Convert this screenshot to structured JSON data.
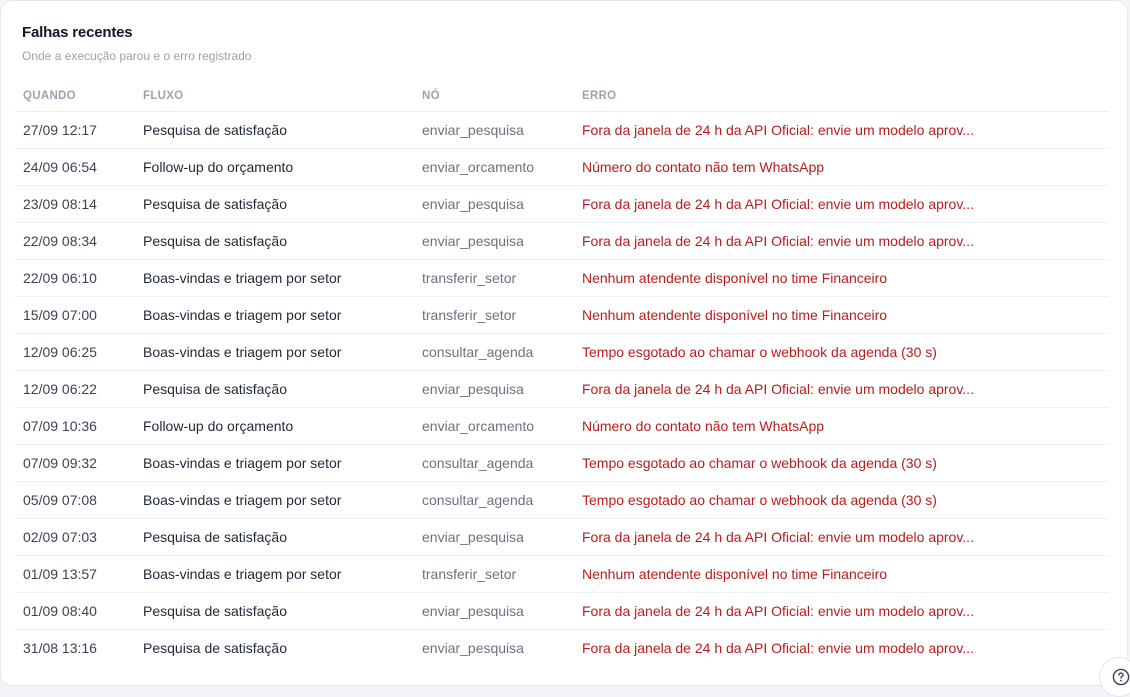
{
  "card": {
    "title": "Falhas recentes",
    "subtitle": "Onde a execução parou e o erro registrado"
  },
  "table": {
    "columns": [
      "QUANDO",
      "FLUXO",
      "NÓ",
      "ERRO"
    ],
    "rows": [
      {
        "when": "27/09 12:17",
        "flow": "Pesquisa de satisfação",
        "node": "enviar_pesquisa",
        "error": "Fora da janela de 24 h da API Oficial: envie um modelo aprov..."
      },
      {
        "when": "24/09 06:54",
        "flow": "Follow-up do orçamento",
        "node": "enviar_orcamento",
        "error": "Número do contato não tem WhatsApp"
      },
      {
        "when": "23/09 08:14",
        "flow": "Pesquisa de satisfação",
        "node": "enviar_pesquisa",
        "error": "Fora da janela de 24 h da API Oficial: envie um modelo aprov..."
      },
      {
        "when": "22/09 08:34",
        "flow": "Pesquisa de satisfação",
        "node": "enviar_pesquisa",
        "error": "Fora da janela de 24 h da API Oficial: envie um modelo aprov..."
      },
      {
        "when": "22/09 06:10",
        "flow": "Boas-vindas e triagem por setor",
        "node": "transferir_setor",
        "error": "Nenhum atendente disponível no time Financeiro"
      },
      {
        "when": "15/09 07:00",
        "flow": "Boas-vindas e triagem por setor",
        "node": "transferir_setor",
        "error": "Nenhum atendente disponível no time Financeiro"
      },
      {
        "when": "12/09 06:25",
        "flow": "Boas-vindas e triagem por setor",
        "node": "consultar_agenda",
        "error": "Tempo esgotado ao chamar o webhook da agenda (30 s)"
      },
      {
        "when": "12/09 06:22",
        "flow": "Pesquisa de satisfação",
        "node": "enviar_pesquisa",
        "error": "Fora da janela de 24 h da API Oficial: envie um modelo aprov..."
      },
      {
        "when": "07/09 10:36",
        "flow": "Follow-up do orçamento",
        "node": "enviar_orcamento",
        "error": "Número do contato não tem WhatsApp"
      },
      {
        "when": "07/09 09:32",
        "flow": "Boas-vindas e triagem por setor",
        "node": "consultar_agenda",
        "error": "Tempo esgotado ao chamar o webhook da agenda (30 s)"
      },
      {
        "when": "05/09 07:08",
        "flow": "Boas-vindas e triagem por setor",
        "node": "consultar_agenda",
        "error": "Tempo esgotado ao chamar o webhook da agenda (30 s)"
      },
      {
        "when": "02/09 07:03",
        "flow": "Pesquisa de satisfação",
        "node": "enviar_pesquisa",
        "error": "Fora da janela de 24 h da API Oficial: envie um modelo aprov..."
      },
      {
        "when": "01/09 13:57",
        "flow": "Boas-vindas e triagem por setor",
        "node": "transferir_setor",
        "error": "Nenhum atendente disponível no time Financeiro"
      },
      {
        "when": "01/09 08:40",
        "flow": "Pesquisa de satisfação",
        "node": "enviar_pesquisa",
        "error": "Fora da janela de 24 h da API Oficial: envie um modelo aprov..."
      },
      {
        "when": "31/08 13:16",
        "flow": "Pesquisa de satisfação",
        "node": "enviar_pesquisa",
        "error": "Fora da janela de 24 h da API Oficial: envie um modelo aprov..."
      }
    ]
  },
  "help": {
    "icon": "help-circle-icon"
  },
  "colors": {
    "error_text": "#b91c1c",
    "header_text": "#9ca3b1",
    "node_text": "#6b7280"
  }
}
